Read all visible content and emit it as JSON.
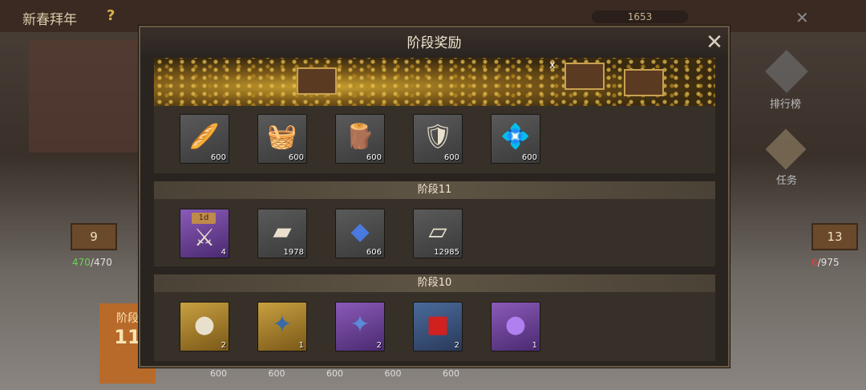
{
  "background": {
    "event_title": "新春拜年",
    "help": "?",
    "currency": "1653",
    "close": "✕",
    "rank_label": "排行榜",
    "task_label": "任务",
    "left_sign": "9",
    "left_progress_done": "470",
    "left_progress_total": "/470",
    "right_sign": "13",
    "right_progress_done": "6",
    "right_progress_total": "/975",
    "stage_label": "阶段",
    "stage_num": "11",
    "bottom_qty": "600 600 600 600 600"
  },
  "modal": {
    "title": "阶段奖励",
    "close_icon": "close-icon",
    "banner_x": "x",
    "top_row": [
      {
        "icon": "speedup-gather-icon",
        "qty": "600"
      },
      {
        "icon": "speedup-food-icon",
        "qty": "600"
      },
      {
        "icon": "speedup-wood-icon",
        "qty": "600"
      },
      {
        "icon": "speedup-stone-icon",
        "qty": "600"
      },
      {
        "icon": "speedup-gem-icon",
        "qty": "600"
      }
    ],
    "stages": [
      {
        "label": "阶段11",
        "items": [
          {
            "icon": "equipment-1d-icon",
            "badge": "1d",
            "qty": "4",
            "color": "purple"
          },
          {
            "icon": "silver-ingot-icon",
            "qty": "1978",
            "color": "grey"
          },
          {
            "icon": "blue-ore-icon",
            "qty": "606",
            "color": "grey"
          },
          {
            "icon": "iron-ingot-icon",
            "qty": "12985",
            "color": "grey"
          }
        ]
      },
      {
        "label": "阶段10",
        "items": [
          {
            "icon": "gold-orb-icon",
            "qty": "2",
            "color": "gold"
          },
          {
            "icon": "gold-puzzle-icon",
            "qty": "1",
            "color": "gold"
          },
          {
            "icon": "purple-puzzle-icon",
            "qty": "2",
            "color": "purple"
          },
          {
            "icon": "red-envelope-icon",
            "qty": "2",
            "color": "blue"
          },
          {
            "icon": "purple-orb-icon",
            "qty": "1",
            "color": "purple"
          }
        ]
      }
    ]
  }
}
